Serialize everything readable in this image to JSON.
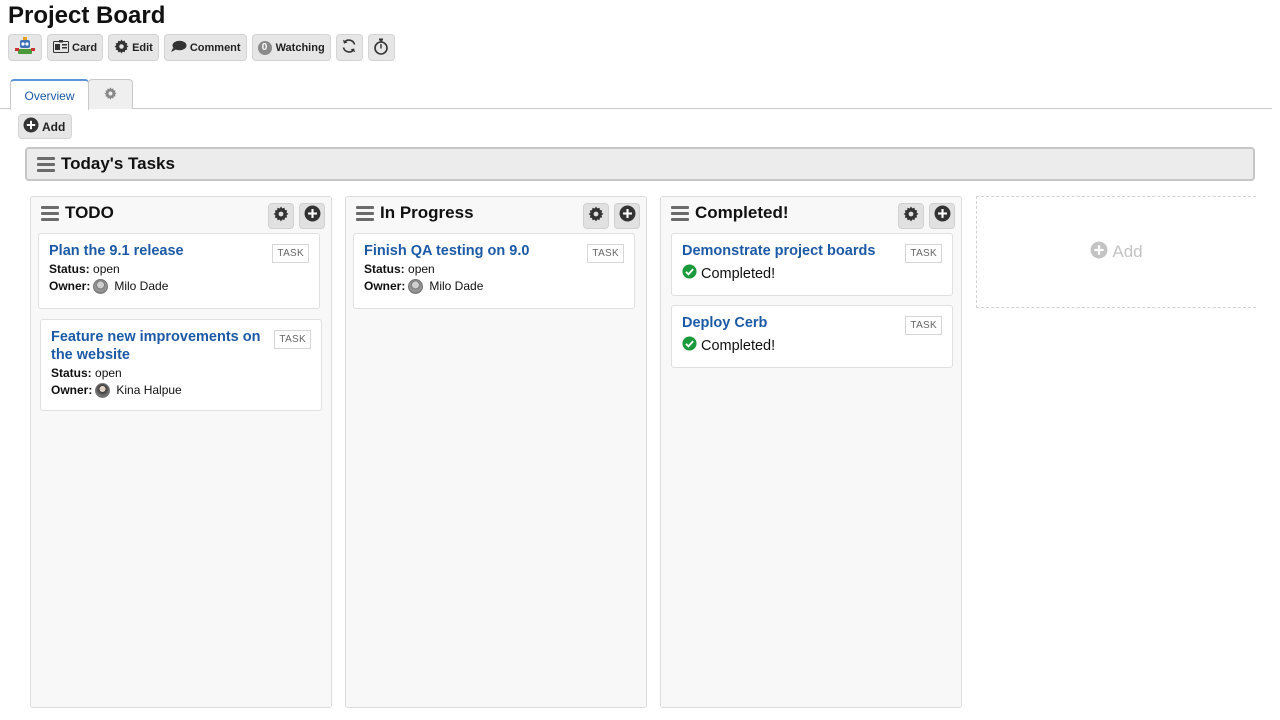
{
  "page": {
    "title": "Project Board"
  },
  "toolbar": {
    "logo_icon": "robot-logo-icon",
    "card_label": "Card",
    "edit_label": "Edit",
    "comment_label": "Comment",
    "watching_count": "0",
    "watching_label": "Watching",
    "refresh_icon": "refresh-icon",
    "timer_icon": "stopwatch-icon"
  },
  "tabs": [
    {
      "label": "Overview",
      "active": true
    },
    {
      "icon": "gear-icon",
      "active": false
    }
  ],
  "add_button": {
    "label": "Add"
  },
  "section": {
    "title": "Today's Tasks"
  },
  "columns": [
    {
      "title": "TODO",
      "cards": [
        {
          "title": "Plan the 9.1 release",
          "badge": "TASK",
          "status_label": "Status:",
          "status": "open",
          "owner_label": "Owner:",
          "owner": "Milo Dade"
        },
        {
          "title": "Feature new improvements on the website",
          "badge": "TASK",
          "status_label": "Status:",
          "status": "open",
          "owner_label": "Owner:",
          "owner": "Kina Halpue"
        }
      ]
    },
    {
      "title": "In Progress",
      "cards": [
        {
          "title": "Finish QA testing on 9.0",
          "badge": "TASK",
          "status_label": "Status:",
          "status": "open",
          "owner_label": "Owner:",
          "owner": "Milo Dade"
        }
      ]
    },
    {
      "title": "Completed!",
      "cards": [
        {
          "title": "Demonstrate project boards",
          "badge": "TASK",
          "completed": "Completed!"
        },
        {
          "title": "Deploy Cerb",
          "badge": "TASK",
          "completed": "Completed!"
        }
      ]
    }
  ],
  "add_column": {
    "label": "Add"
  },
  "colors": {
    "link": "#1d5aa6",
    "success": "#1a9a3a",
    "tab_accent": "#5c94d6"
  }
}
